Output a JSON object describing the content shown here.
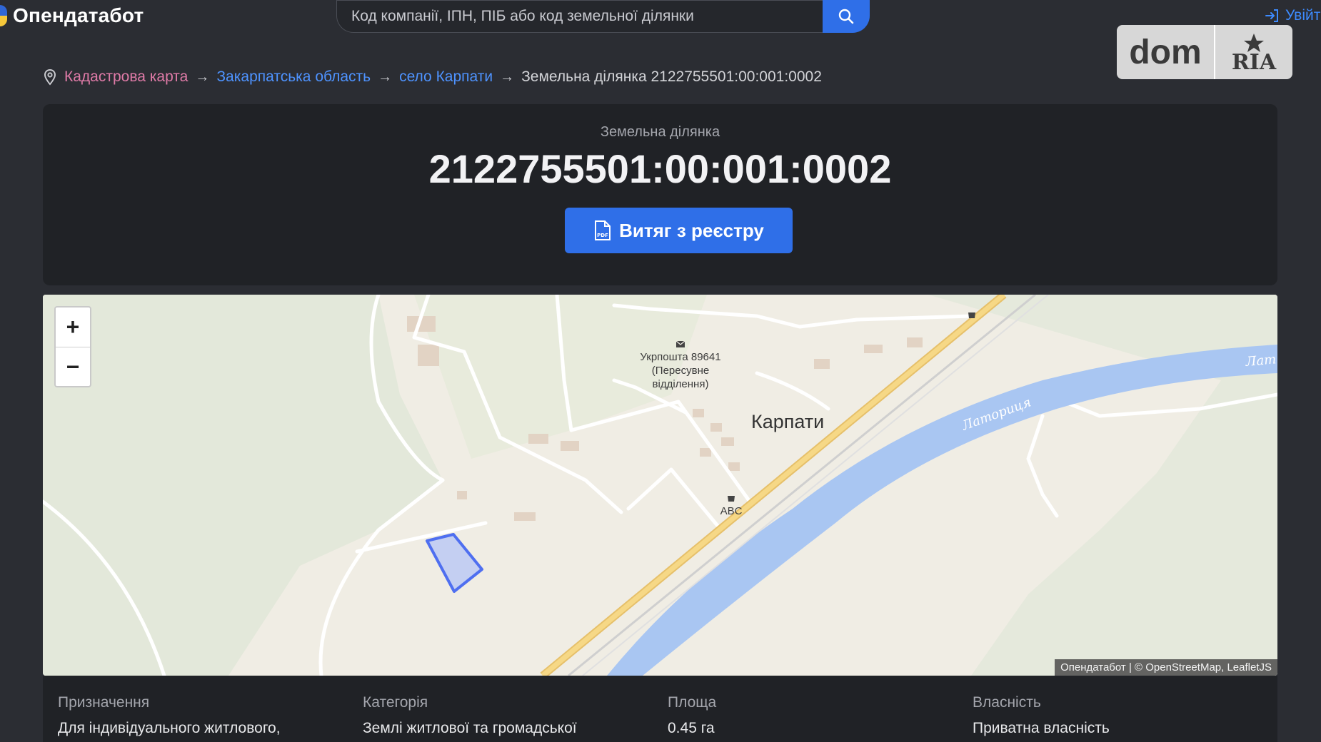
{
  "header": {
    "logo_text": "Опендатабот",
    "search_placeholder": "Код компанії, ІПН, ПІБ або код земельної ділянки",
    "login_label": "Увійти"
  },
  "watermark": {
    "dom": "dom",
    "ria": "RIA"
  },
  "breadcrumb": {
    "items": [
      "Кадастрова карта",
      "Закарпатська область",
      "село Карпати",
      "Земельна ділянка 2122755501:00:001:0002"
    ]
  },
  "parcel": {
    "label": "Земельна ділянка",
    "cadastral_number": "2122755501:00:001:0002",
    "extract_button": "Витяг з реєстру"
  },
  "map": {
    "zoom_in": "+",
    "zoom_out": "−",
    "post_office": [
      "Укрпошта 89641",
      "(Пересувне",
      "відділення)"
    ],
    "place": "Карпати",
    "shop": "ABC",
    "river": "Латориця",
    "river_edge": "Лат",
    "attribution": "Опендатабот | © OpenStreetMap, LeafletJS",
    "colors": {
      "land": "#f0ede4",
      "forest": "#e3e8da",
      "river": "#a9c6f2",
      "road": "#f2d27a",
      "parcel": "#4f6ff0"
    }
  },
  "properties": [
    {
      "label": "Призначення",
      "value": "Для індивідуального житлового,"
    },
    {
      "label": "Категорія",
      "value": "Землі житлової та громадської"
    },
    {
      "label": "Площа",
      "value": "0.45 га"
    },
    {
      "label": "Власність",
      "value": "Приватна власність"
    }
  ]
}
